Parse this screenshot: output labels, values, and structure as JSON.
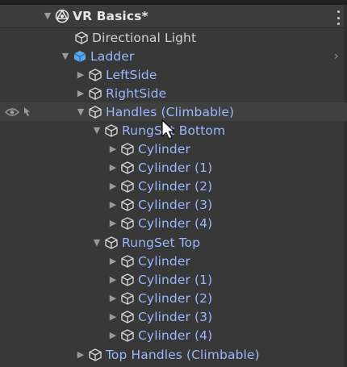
{
  "scene": {
    "title": "VR Basics*"
  },
  "tree": {
    "directional_light": "Directional Light",
    "ladder": "Ladder",
    "left_side": "LeftSide",
    "right_side": "RightSide",
    "handles": "Handles (Climbable)",
    "rungset_bottom": "RungSet Bottom",
    "bottom_cylinders": [
      "Cylinder",
      "Cylinder (1)",
      "Cylinder (2)",
      "Cylinder (3)",
      "Cylinder (4)"
    ],
    "rungset_top": "RungSet Top",
    "top_cylinders": [
      "Cylinder",
      "Cylinder (1)",
      "Cylinder (2)",
      "Cylinder (3)",
      "Cylinder (4)"
    ],
    "top_handles": "Top Handles (Climbable)"
  },
  "icons": {
    "scene": "unity-logo-icon",
    "gameobject": "cube-outline-icon",
    "prefab": "prefab-cube-icon",
    "visibility": "eye-icon",
    "pickability": "hand-pointer-icon",
    "options": "kebab-menu-icon"
  },
  "colors": {
    "background": "#383838",
    "text": "#d2d2d2",
    "prefab_text": "#9bb7ff",
    "prefab_icon": "#5aa7f0"
  }
}
